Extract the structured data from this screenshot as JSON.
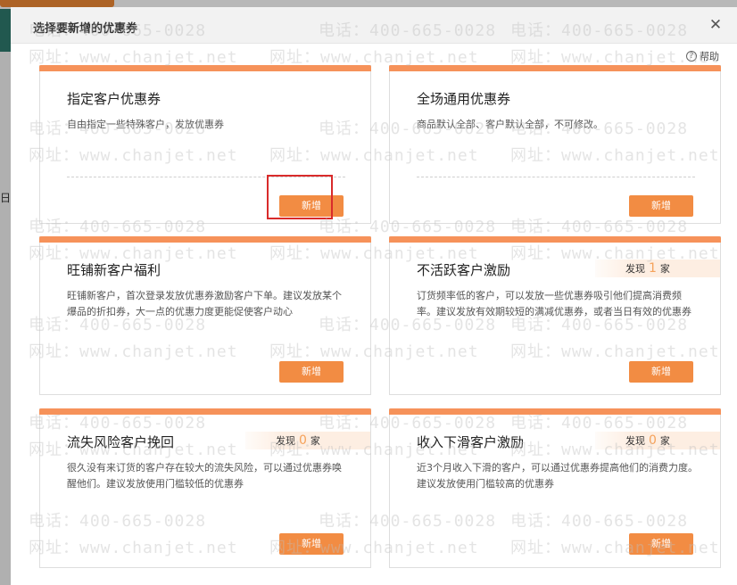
{
  "modal": {
    "title": "选择要新增的优惠券",
    "close_symbol": "✕",
    "help_label": "帮助",
    "help_symbol": "?"
  },
  "background": {
    "side_char": "日"
  },
  "cards": [
    {
      "title": "指定客户优惠券",
      "desc": "自由指定一些特殊客户，发放优惠券",
      "button": "新增"
    },
    {
      "title": "全场通用优惠券",
      "desc": "商品默认全部、客户默认全部，不可修改。",
      "button": "新增"
    },
    {
      "title": "旺铺新客户福利",
      "desc": "旺铺新客户，首次登录发放优惠券激励客户下单。建议发放某个爆品的折扣券，大一点的优惠力度更能促使客户动心",
      "button": "新增"
    },
    {
      "title": "不活跃客户激励",
      "desc": "订货频率低的客户，可以发放一些优惠券吸引他们提高消费频率。建议发放有效期较短的满减优惠券，或者当日有效的优惠券",
      "button": "新增",
      "found_prefix": "发现",
      "found_count": "1",
      "found_suffix": "家"
    },
    {
      "title": "流失风险客户挽回",
      "desc": "很久没有来订货的客户存在较大的流失风险，可以通过优惠券唤醒他们。建议发放使用门槛较低的优惠券",
      "button": "新增",
      "found_prefix": "发现",
      "found_count": "0",
      "found_suffix": "家"
    },
    {
      "title": "收入下滑客户激励",
      "desc": "近3个月收入下滑的客户，可以通过优惠券提高他们的消费力度。建议发放使用门槛较高的优惠券",
      "button": "新增",
      "found_prefix": "发现",
      "found_count": "0",
      "found_suffix": "家"
    }
  ],
  "watermark": {
    "phone": "电话：400-665-0028",
    "site": "网址：www.chanjet.net"
  },
  "colors": {
    "accent": "#f28c43",
    "card_bar": "#f6925a",
    "highlight_box": "#d92b2b",
    "found_count": "#f5a25a"
  }
}
